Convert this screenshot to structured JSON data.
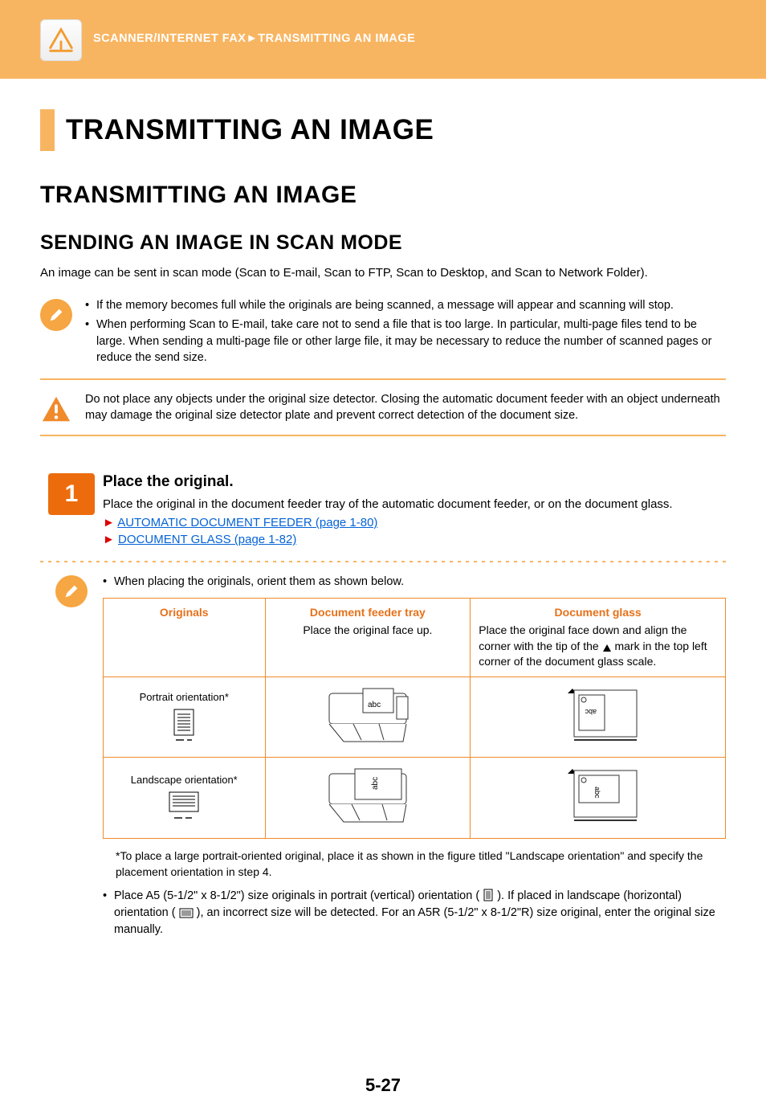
{
  "header": {
    "breadcrumb": "SCANNER/INTERNET FAX►TRANSMITTING AN IMAGE"
  },
  "chapter_title": "TRANSMITTING AN IMAGE",
  "section_title": "TRANSMITTING AN IMAGE",
  "subsection_title": "SENDING AN IMAGE IN SCAN MODE",
  "intro": "An image can be sent in scan mode (Scan to E-mail, Scan to FTP, Scan to Desktop, and Scan to Network Folder).",
  "notes": {
    "item1": "If the memory becomes full while the originals are being scanned, a message will appear and scanning will stop.",
    "item2": "When performing Scan to E-mail, take care not to send a file that is too large. In particular, multi-page files tend to be large. When sending a multi-page file or other large file, it may be necessary to reduce the number of scanned pages or reduce the send size."
  },
  "warning": "Do not place any objects under the original size detector. Closing the automatic document feeder with an object underneath may damage the original size detector plate and prevent correct detection of the document size.",
  "step1": {
    "number": "1",
    "title": "Place the original.",
    "text": "Place the original in the document feeder tray of the automatic document feeder, or on the document glass.",
    "link1": "AUTOMATIC DOCUMENT FEEDER (page 1-80)",
    "link2": "DOCUMENT GLASS (page 1-82)"
  },
  "inner_note_lead": "When placing the originals, orient them as shown below.",
  "table": {
    "h1": "Originals",
    "h2": "Document feeder tray",
    "h2sub": "Place the original face up.",
    "h3": "Document glass",
    "h3sub_a": "Place the original face down and align the corner with the tip of the ",
    "h3sub_b": " mark in the top left corner of the document glass scale.",
    "r1": "Portrait orientation*",
    "r2": "Landscape orientation*"
  },
  "star_note": "*To place a large portrait-oriented original, place it as shown in the figure titled \"Landscape orientation\" and specify the placement orientation in step 4.",
  "bullet_note_a": "Place A5 (5-1/2\" x 8-1/2\") size originals in portrait (vertical) orientation ( ",
  "bullet_note_b": " ). If placed in landscape (horizontal) orientation ( ",
  "bullet_note_c": " ), an incorrect size will be detected. For an A5R (5-1/2\" x 8-1/2\"R) size original, enter the original size manually.",
  "page_number": "5-27"
}
